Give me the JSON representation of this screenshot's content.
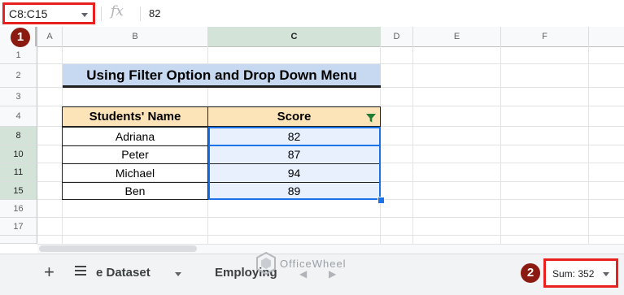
{
  "formula_bar": {
    "name_box": "C8:C15",
    "fx": "fx",
    "formula": "82"
  },
  "columns": [
    "A",
    "B",
    "C",
    "D",
    "E",
    "F"
  ],
  "rows": [
    "1",
    "2",
    "3",
    "4",
    "8",
    "10",
    "11",
    "15",
    "16",
    "17"
  ],
  "title": "Using Filter Option and Drop Down Menu",
  "table": {
    "headers": [
      "Students' Name",
      "Score"
    ],
    "rows": [
      {
        "name": "Adriana",
        "score": "82"
      },
      {
        "name": "Peter",
        "score": "87"
      },
      {
        "name": "Michael",
        "score": "94"
      },
      {
        "name": "Ben",
        "score": "89"
      }
    ]
  },
  "bottom_bar": {
    "add_sheet": "+",
    "tabs": [
      "e Dataset",
      "Employing"
    ],
    "nav_left": "◀",
    "nav_right": "▶",
    "watermark": "OfficeWheel",
    "sum": "Sum: 352"
  },
  "annotations": [
    "1",
    "2"
  ],
  "colors": {
    "selection": "#1a73e8",
    "highlight_box": "#e8211e",
    "badge": "#8b1a10",
    "title_fill": "#c6d9f1",
    "header_fill": "#fce4b8",
    "filter_icon": "#1e7e34"
  }
}
